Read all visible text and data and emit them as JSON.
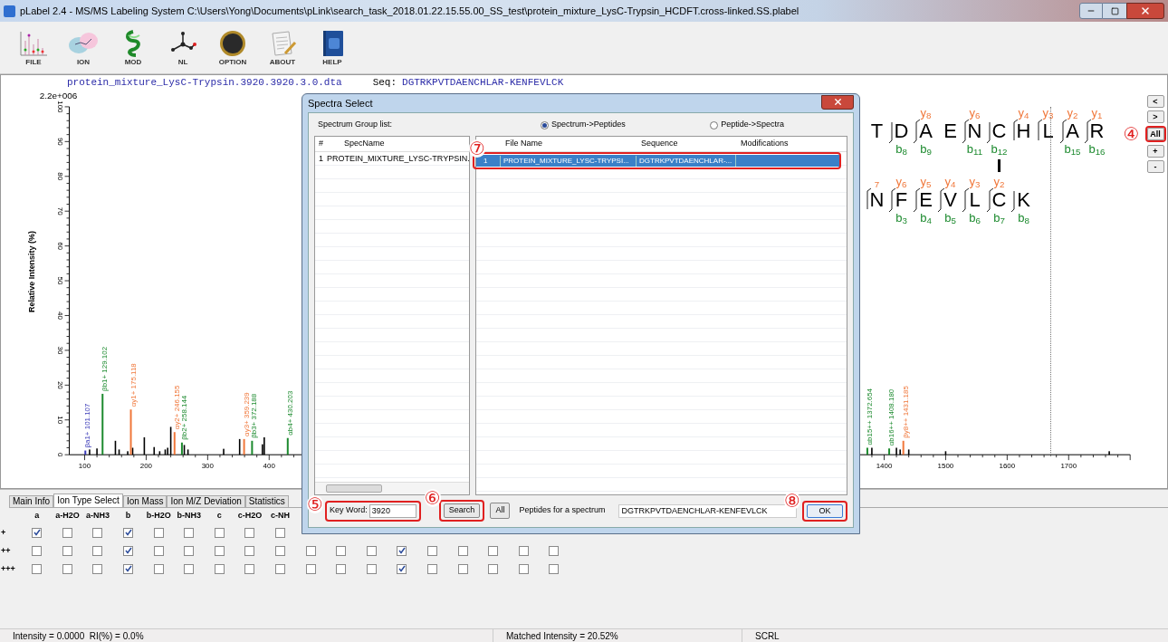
{
  "window": {
    "title": "pLabel 2.4 - MS/MS Labeling System C:\\Users\\Yong\\Documents\\pLink\\search_task_2018.01.22.15.55.00_SS_test\\protein_mixture_LysC-Trypsin_HCDFT.cross-linked.SS.plabel"
  },
  "toolbar": [
    {
      "kind": "spectrum",
      "label": "FILE"
    },
    {
      "kind": "molecule",
      "label": "ION"
    },
    {
      "kind": "ribbon",
      "label": "MOD"
    },
    {
      "kind": "graph",
      "label": "NL"
    },
    {
      "kind": "compass",
      "label": "OPTION"
    },
    {
      "kind": "document",
      "label": "ABOUT"
    },
    {
      "kind": "book",
      "label": "HELP"
    }
  ],
  "spectrum": {
    "file": "protein_mixture_LysC-Trypsin.3920.3920.3.0.dta",
    "seq_label": "Seq:",
    "sequence": "DGTRKPVTDAENCHLAR-KENFEVLCK",
    "scale": "2.2e+006",
    "chart_data": {
      "type": "bar",
      "ylabel": "Relative Intensity (%)",
      "xlim": [
        75,
        1800
      ],
      "ylim": [
        0,
        100
      ],
      "yticks": [
        0,
        10,
        20,
        30,
        40,
        50,
        60,
        70,
        80,
        90,
        100
      ],
      "xticks": [
        100,
        200,
        300,
        400,
        1400,
        1500,
        1600,
        1700
      ],
      "x": [
        101.107,
        108,
        120,
        129.102,
        150,
        156,
        170,
        175.118,
        178,
        197,
        213,
        222,
        231,
        235,
        240,
        246.155,
        258.144,
        262,
        268,
        326,
        352,
        359.239,
        372.188,
        389,
        392,
        430.203,
        1372.654,
        1380,
        1408.18,
        1420,
        1426,
        1431.185,
        1440,
        1500,
        1766
      ],
      "series": [
        {
          "color": "#000000",
          "values": [
            null,
            1.5,
            1.8,
            null,
            4,
            1.5,
            1,
            null,
            2,
            5,
            2.2,
            1,
            1.5,
            2,
            8,
            null,
            null,
            2.8,
            1.5,
            1.7,
            4.5,
            null,
            null,
            3,
            5,
            null,
            null,
            2,
            null,
            2,
            1.5,
            null,
            1.5,
            1,
            1
          ]
        },
        {
          "color": "#3a3ab8",
          "values": [
            1.2,
            null,
            null,
            null,
            null,
            null,
            null,
            null,
            null,
            null,
            null,
            null,
            null,
            null,
            null,
            null,
            null,
            null,
            null,
            null,
            null,
            null,
            null,
            null,
            null,
            null,
            null,
            null,
            null,
            null,
            null,
            null,
            null,
            null,
            null
          ]
        },
        {
          "color": "#1c8a2e",
          "values": [
            null,
            null,
            null,
            17.5,
            null,
            null,
            null,
            null,
            null,
            null,
            null,
            null,
            null,
            null,
            null,
            null,
            3.5,
            null,
            null,
            null,
            null,
            null,
            4,
            null,
            null,
            4.8,
            2,
            null,
            1.8,
            null,
            null,
            null,
            null,
            null,
            null
          ]
        },
        {
          "color": "#f0773a",
          "values": [
            null,
            null,
            null,
            null,
            null,
            null,
            null,
            13,
            null,
            null,
            null,
            null,
            null,
            null,
            null,
            6.5,
            null,
            null,
            null,
            null,
            null,
            4.5,
            null,
            null,
            null,
            null,
            null,
            null,
            null,
            null,
            null,
            4,
            null,
            null,
            null
          ]
        }
      ],
      "annotations": [
        {
          "x": 101.107,
          "y": 1.2,
          "text": "βa1+ 101.107"
        },
        {
          "x": 129.102,
          "y": 17.5,
          "text": "βb1+ 129.102"
        },
        {
          "x": 175.118,
          "y": 13,
          "text": "αy1+ 175.118"
        },
        {
          "x": 246.155,
          "y": 6.5,
          "text": "αy2+ 246.155"
        },
        {
          "x": 258.144,
          "y": 3.5,
          "text": "βb2+ 258.144"
        },
        {
          "x": 359.239,
          "y": 4.5,
          "text": "αy3+ 359.239"
        },
        {
          "x": 372.188,
          "y": 4,
          "text": "βb3+ 372.188"
        },
        {
          "x": 430.203,
          "y": 4.8,
          "text": "αb4+ 430.203"
        },
        {
          "x": 1372.654,
          "y": 2,
          "text": "αb15++ 1372.654"
        },
        {
          "x": 1408.18,
          "y": 1.8,
          "text": "αb16++ 1408.180"
        },
        {
          "x": 1431.185,
          "y": 4,
          "text": "βy8++ 1431.185"
        }
      ]
    }
  },
  "peptide_map": {
    "lines": [
      {
        "residues": [
          {
            "aa": "T",
            "linked": false
          },
          {
            "aa": "D",
            "b": "b$_{8}$",
            "linked": false
          },
          {
            "aa": "A",
            "b": "b$_{9}$",
            "y": "y$_{8}$",
            "linked": false
          },
          {
            "aa": "E",
            "linked": false
          },
          {
            "aa": "N",
            "b": "b$_{11}$",
            "y": "y$_{6}$",
            "linked": false
          },
          {
            "aa": "C",
            "b": "b$_{12}$",
            "linked": true
          },
          {
            "aa": "H",
            "y": "y$_{4}$",
            "linked": false
          },
          {
            "aa": "L",
            "y": "y$_{3}$",
            "linked": false
          },
          {
            "aa": "A",
            "b": "b$_{15}$",
            "y": "y$_{2}$",
            "linked": false
          },
          {
            "aa": "R",
            "b": "b$_{16}$",
            "y": "y$_{1}$",
            "linked": false
          }
        ]
      },
      {
        "residues": [
          {
            "aa": "N",
            "y": "$_{7}$"
          },
          {
            "aa": "F",
            "b": "b$_{3}$",
            "y": "y$_{6}$"
          },
          {
            "aa": "E",
            "b": "b$_{4}$",
            "y": "y$_{5}$"
          },
          {
            "aa": "V",
            "b": "b$_{5}$",
            "y": "y$_{4}$"
          },
          {
            "aa": "L",
            "b": "b$_{6}$",
            "y": "y$_{3}$"
          },
          {
            "aa": "C",
            "b": "b$_{7}$",
            "y": "y$_{2}$"
          },
          {
            "aa": "K",
            "b": "b$_{8}$"
          }
        ]
      }
    ]
  },
  "view_buttons": [
    {
      "label": "<"
    },
    {
      "label": ">"
    },
    {
      "label": "All",
      "callout": "④"
    },
    {
      "label": "+"
    },
    {
      "label": "-"
    }
  ],
  "dialog": {
    "title": "Spectra Select",
    "group_label": "Spectrum Group list:",
    "modes": [
      {
        "label": "Spectrum->Peptides",
        "selected": true
      },
      {
        "label": "Peptide->Spectra",
        "selected": false
      }
    ],
    "spec_table": {
      "columns": [
        "#",
        "SpecName"
      ],
      "rows": [
        [
          "1",
          "PROTEIN_MIXTURE_LYSC-TRYPSIN."
        ]
      ]
    },
    "peptide_table": {
      "columns": [
        "File Name",
        "Sequence",
        "Modifications"
      ],
      "callout": "⑦",
      "rows": [
        {
          "index": "1",
          "cells": [
            "PROTEIN_MIXTURE_LYSC-TRYPSI...",
            "DGTRKPVTDAENCHLAR-..."
          ],
          "selected": true
        }
      ]
    },
    "keyword": {
      "label": "Key Word:",
      "value": "3920",
      "callout": "⑤"
    },
    "search_button": {
      "label": "Search",
      "callout": "⑥"
    },
    "all_button": {
      "label": "All"
    },
    "peptides_label": "Peptides for a spectrum",
    "peptide_value": "DGTRKPVTDAENCHLAR-KENFEVLCK",
    "ok_button": {
      "label": "OK",
      "callout": "⑧"
    }
  },
  "bottom_tabs": [
    {
      "label": "Main Info",
      "selected": false
    },
    {
      "label": "Ion Type Select",
      "selected": true
    },
    {
      "label": "Ion Mass",
      "selected": false
    },
    {
      "label": "Ion M/Z Deviation",
      "selected": false
    },
    {
      "label": "Statistics",
      "selected": false
    }
  ],
  "ion_types": {
    "columns": [
      "a",
      "a-H2O",
      "a-NH3",
      "b",
      "b-H2O",
      "b-NH3",
      "c",
      "c-H2O",
      "c-NH"
    ],
    "rows": [
      {
        "label": "+",
        "checks": [
          true,
          false,
          false,
          true,
          false,
          false,
          false,
          false,
          false
        ]
      },
      {
        "label": "++",
        "checks": [
          false,
          false,
          false,
          true,
          false,
          false,
          false,
          false,
          false,
          false,
          false,
          false,
          true,
          false,
          false,
          false,
          false,
          false
        ]
      },
      {
        "label": "+++",
        "checks": [
          false,
          false,
          false,
          true,
          false,
          false,
          false,
          false,
          false,
          false,
          false,
          false,
          true,
          false,
          false,
          false,
          false,
          false
        ]
      }
    ]
  },
  "status_bar": [
    "Intensity = 0.0000  RI(%) = 0.0%",
    "Matched Intensity = 20.52%",
    "SCRL"
  ]
}
